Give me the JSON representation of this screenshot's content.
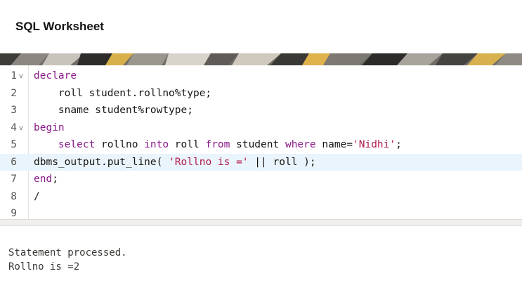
{
  "header": {
    "title": "SQL Worksheet"
  },
  "editor": {
    "lines": [
      {
        "num": "1",
        "fold": "v",
        "tokens": [
          {
            "t": "declare",
            "c": "kw"
          }
        ]
      },
      {
        "num": "2",
        "fold": "",
        "tokens": [
          {
            "t": "    roll student.rollno%type;",
            "c": "plain"
          }
        ]
      },
      {
        "num": "3",
        "fold": "",
        "tokens": [
          {
            "t": "    sname student%rowtype;",
            "c": "plain"
          }
        ]
      },
      {
        "num": "4",
        "fold": "v",
        "tokens": [
          {
            "t": "begin",
            "c": "kw"
          }
        ]
      },
      {
        "num": "5",
        "fold": "",
        "tokens": [
          {
            "t": "    ",
            "c": "plain"
          },
          {
            "t": "select",
            "c": "kw"
          },
          {
            "t": " rollno ",
            "c": "plain"
          },
          {
            "t": "into",
            "c": "kw"
          },
          {
            "t": " roll ",
            "c": "plain"
          },
          {
            "t": "from",
            "c": "kw"
          },
          {
            "t": " student ",
            "c": "plain"
          },
          {
            "t": "where",
            "c": "kw"
          },
          {
            "t": " name=",
            "c": "plain"
          },
          {
            "t": "'Nidhi'",
            "c": "str"
          },
          {
            "t": ";",
            "c": "plain"
          }
        ]
      },
      {
        "num": "6",
        "fold": "",
        "active": true,
        "tokens": [
          {
            "t": "dbms_output.put_line( ",
            "c": "plain"
          },
          {
            "t": "'Rollno is ='",
            "c": "str"
          },
          {
            "t": " || roll );",
            "c": "plain"
          }
        ]
      },
      {
        "num": "7",
        "fold": "",
        "tokens": [
          {
            "t": "end",
            "c": "kw"
          },
          {
            "t": ";",
            "c": "plain"
          }
        ]
      },
      {
        "num": "8",
        "fold": "",
        "tokens": [
          {
            "t": "/",
            "c": "plain"
          }
        ]
      },
      {
        "num": "9",
        "fold": "",
        "tokens": []
      }
    ]
  },
  "output": {
    "lines": [
      "Statement processed.",
      "Rollno is =2"
    ]
  },
  "colors": {
    "keyword": "#8a1a8a",
    "string": "#b01a4a",
    "active_line": "#eaf4fc"
  }
}
